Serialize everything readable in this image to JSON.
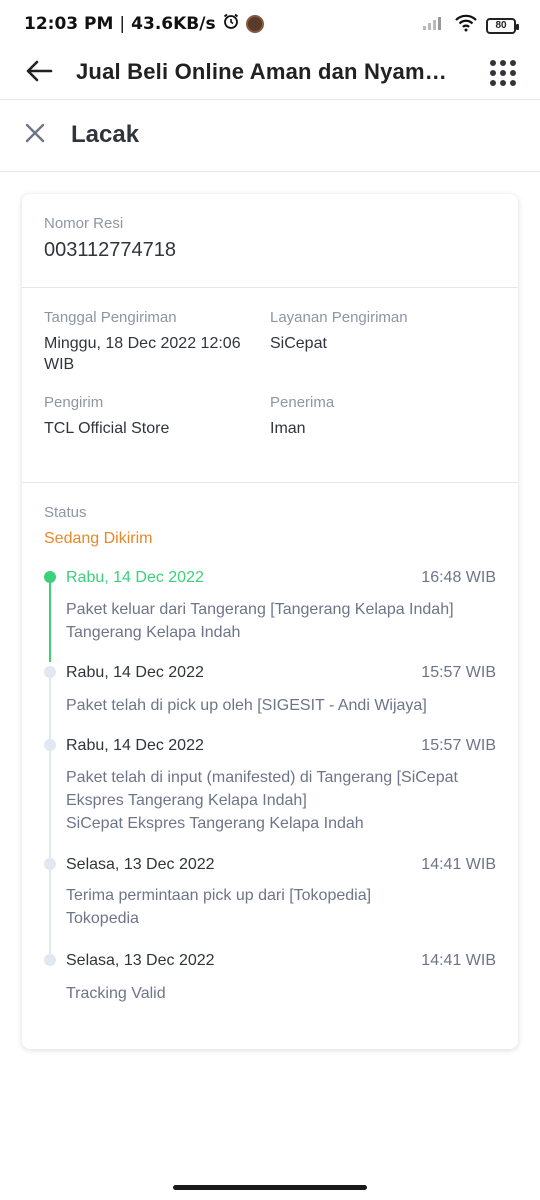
{
  "status_bar": {
    "time": "12:03 PM",
    "separator": "|",
    "speed": "43.6KB/s",
    "battery": "80"
  },
  "header": {
    "title": "Jual Beli Online Aman dan Nyaman | Tokopedia",
    "back_icon": "arrow-left-icon",
    "menu_icon": "grid-menu-icon"
  },
  "subheader": {
    "title": "Lacak",
    "close_icon": "close-icon"
  },
  "tracking": {
    "resi_label": "Nomor Resi",
    "resi_value": "003112774718",
    "ship_date_label": "Tanggal Pengiriman",
    "ship_date_value": "Minggu, 18 Dec 2022 12:06 WIB",
    "service_label": "Layanan Pengiriman",
    "service_value": "SiCepat",
    "sender_label": "Pengirim",
    "sender_value": "TCL Official Store",
    "receiver_label": "Penerima",
    "receiver_value": "Iman",
    "status_label": "Status",
    "status_value": "Sedang Dikirim",
    "events": [
      {
        "date": "Rabu, 14 Dec 2022",
        "time": "16:48 WIB",
        "desc": "Paket keluar dari Tangerang [Tangerang Kelapa Indah]\nTangerang Kelapa Indah"
      },
      {
        "date": "Rabu, 14 Dec 2022",
        "time": "15:57 WIB",
        "desc": "Paket telah di pick up oleh [SIGESIT - Andi Wijaya]"
      },
      {
        "date": "Rabu, 14 Dec 2022",
        "time": "15:57 WIB",
        "desc": "Paket telah di input (manifested) di Tangerang [SiCepat Ekspres Tangerang Kelapa Indah]\nSiCepat Ekspres Tangerang Kelapa Indah"
      },
      {
        "date": "Selasa, 13 Dec 2022",
        "time": "14:41 WIB",
        "desc": "Terima permintaan pick up dari [Tokopedia]\nTokopedia"
      },
      {
        "date": "Selasa, 13 Dec 2022",
        "time": "14:41 WIB",
        "desc": "Tracking Valid"
      }
    ]
  },
  "colors": {
    "accent_green": "#3dd07a",
    "status_orange": "#e8882b",
    "text_dark": "#31353b",
    "text_muted": "#8d96a3"
  }
}
